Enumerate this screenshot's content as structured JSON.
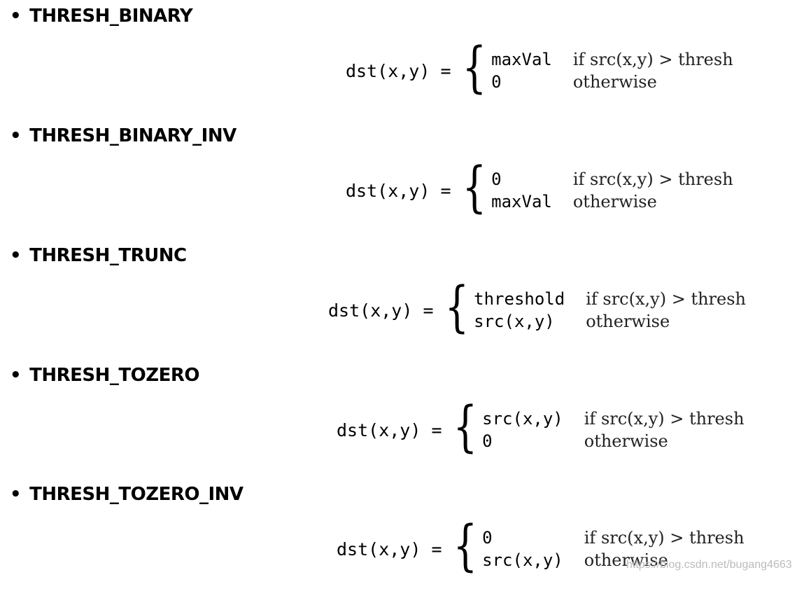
{
  "items": [
    {
      "title": "THRESH_BINARY",
      "lhs": "dst(x,y) =",
      "cases": [
        {
          "value": "maxVal",
          "condition": "if src(x,y) > thresh"
        },
        {
          "value": "0",
          "condition": "otherwise"
        }
      ]
    },
    {
      "title": "THRESH_BINARY_INV",
      "lhs": "dst(x,y) =",
      "cases": [
        {
          "value": "0",
          "condition": "if src(x,y) > thresh"
        },
        {
          "value": "maxVal",
          "condition": "otherwise"
        }
      ]
    },
    {
      "title": "THRESH_TRUNC",
      "lhs": "dst(x,y) =",
      "cases": [
        {
          "value": "threshold",
          "condition": "if src(x,y) > thresh"
        },
        {
          "value": "src(x,y)",
          "condition": "otherwise"
        }
      ]
    },
    {
      "title": "THRESH_TOZERO",
      "lhs": "dst(x,y) =",
      "cases": [
        {
          "value": "src(x,y)",
          "condition": "if src(x,y) > thresh"
        },
        {
          "value": "0",
          "condition": "otherwise"
        }
      ]
    },
    {
      "title": "THRESH_TOZERO_INV",
      "lhs": "dst(x,y) =",
      "cases": [
        {
          "value": "0",
          "condition": "if src(x,y) > thresh"
        },
        {
          "value": "src(x,y)",
          "condition": "otherwise"
        }
      ]
    }
  ],
  "watermark": "https://blog.csdn.net/bugang4663"
}
